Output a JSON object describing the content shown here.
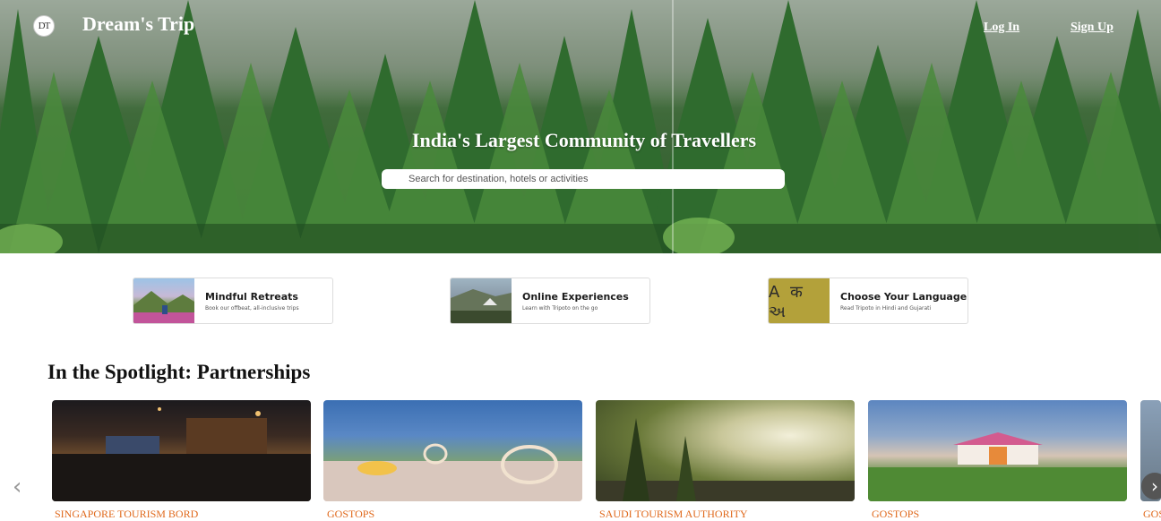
{
  "header": {
    "logo_text": "DT",
    "brand": "Dream's Trip",
    "login_label": "Log In",
    "signup_label": "Sign Up"
  },
  "hero": {
    "title": "India's Largest Community of Travellers",
    "search_placeholder": "Search for destination, hotels or activities"
  },
  "features": [
    {
      "title": "Mindful Retreats",
      "subtitle": "Book our offbeat, all-inclusive trips",
      "icon": "mountain-retreat-image"
    },
    {
      "title": "Online Experiences",
      "subtitle": "Learn with Tripoto on the go",
      "icon": "camping-image"
    },
    {
      "title": "Choose Your Language",
      "subtitle": "Read Tripoto in Hindi and Gujarati",
      "icon": "language-glyphs",
      "glyphs": "A क અ"
    }
  ],
  "spotlight": {
    "title": "In the Spotlight: Partnerships",
    "partners": [
      {
        "name": "SINGAPORE TOURISM BORD"
      },
      {
        "name": "GOSTOPS"
      },
      {
        "name": "SAUDI TOURISM AUTHORITY"
      },
      {
        "name": "GOSTOPS"
      },
      {
        "name": "GOSTOPS"
      }
    ],
    "prev_icon": "chevron-left-icon",
    "next_icon": "chevron-right-icon"
  },
  "colors": {
    "accent_label": "#e0691c",
    "hero_text": "#ffffff",
    "language_tile": "#b3a13a"
  }
}
